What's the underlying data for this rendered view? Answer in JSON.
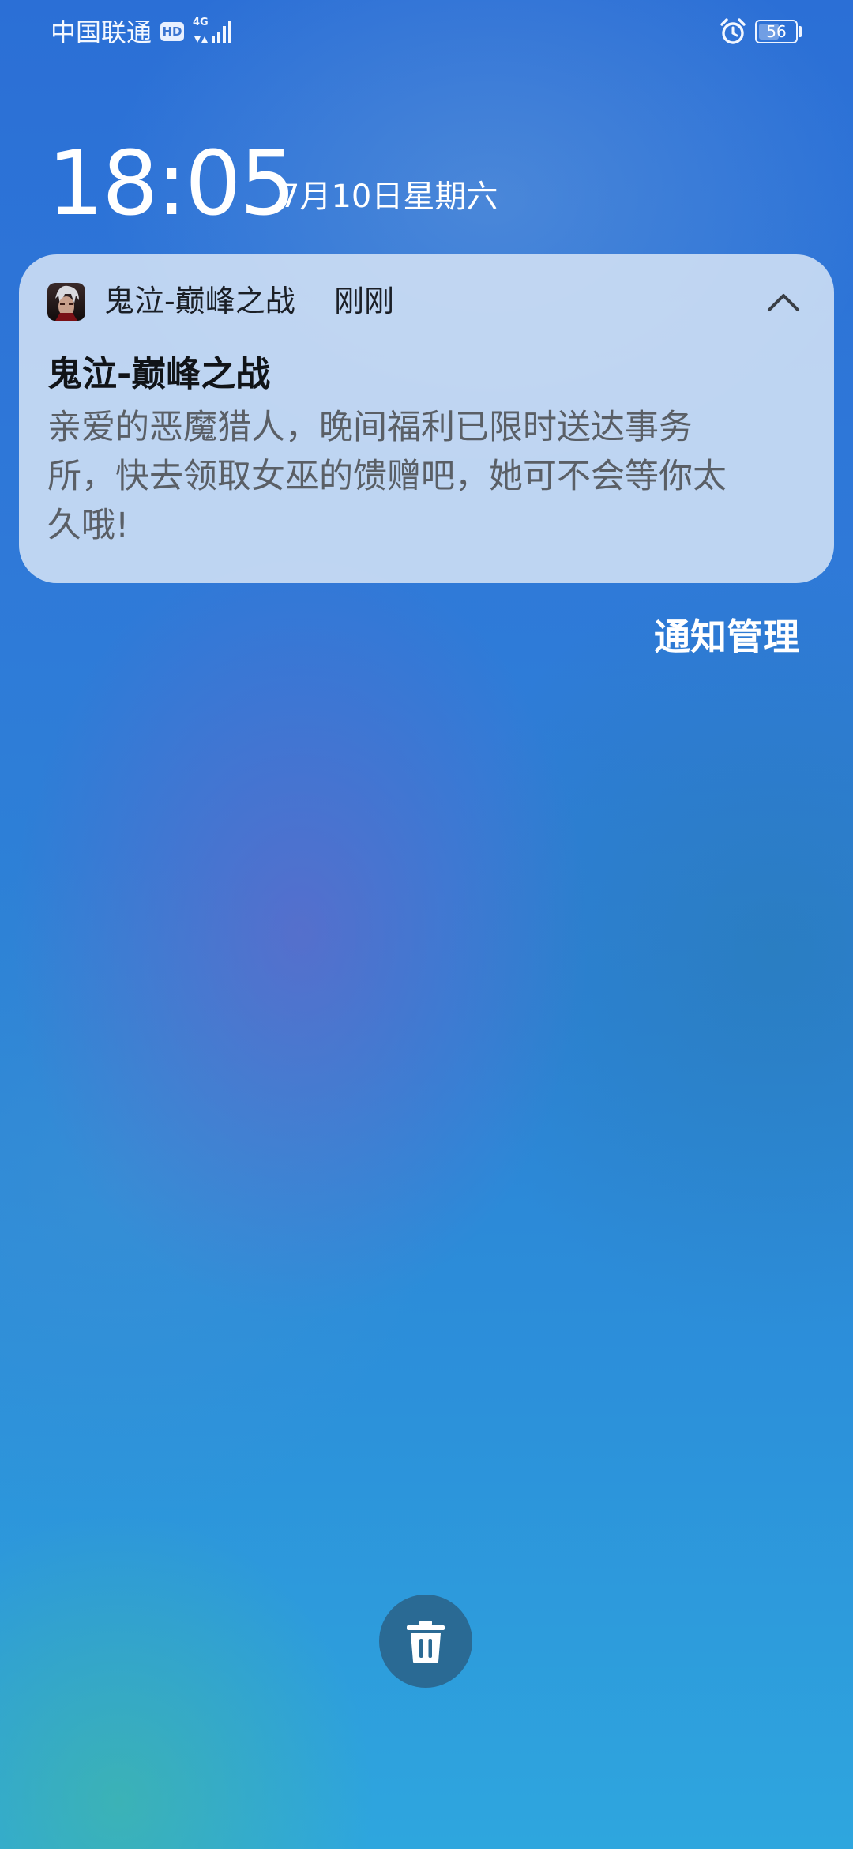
{
  "status_bar": {
    "carrier": "中国联通",
    "hd_badge": "HD",
    "network_type": "4G",
    "battery_level": "56",
    "icons": [
      "hd-icon",
      "signal-icon",
      "alarm-icon",
      "battery-icon"
    ]
  },
  "lock_screen": {
    "time": "18:05",
    "date": "7月10日星期六"
  },
  "notification": {
    "app_name": "鬼泣-巅峰之战",
    "time": "刚刚",
    "title": "鬼泣-巅峰之战",
    "body": "亲爱的恶魔猎人，晚间福利已限时送达事务\n所，快去领取女巫的馈赠吧，她可不会等你太\n久哦!",
    "collapse_icon": "chevron-up-icon"
  },
  "manage_notifications_label": "通知管理",
  "clear_all_icon": "trash-icon"
}
